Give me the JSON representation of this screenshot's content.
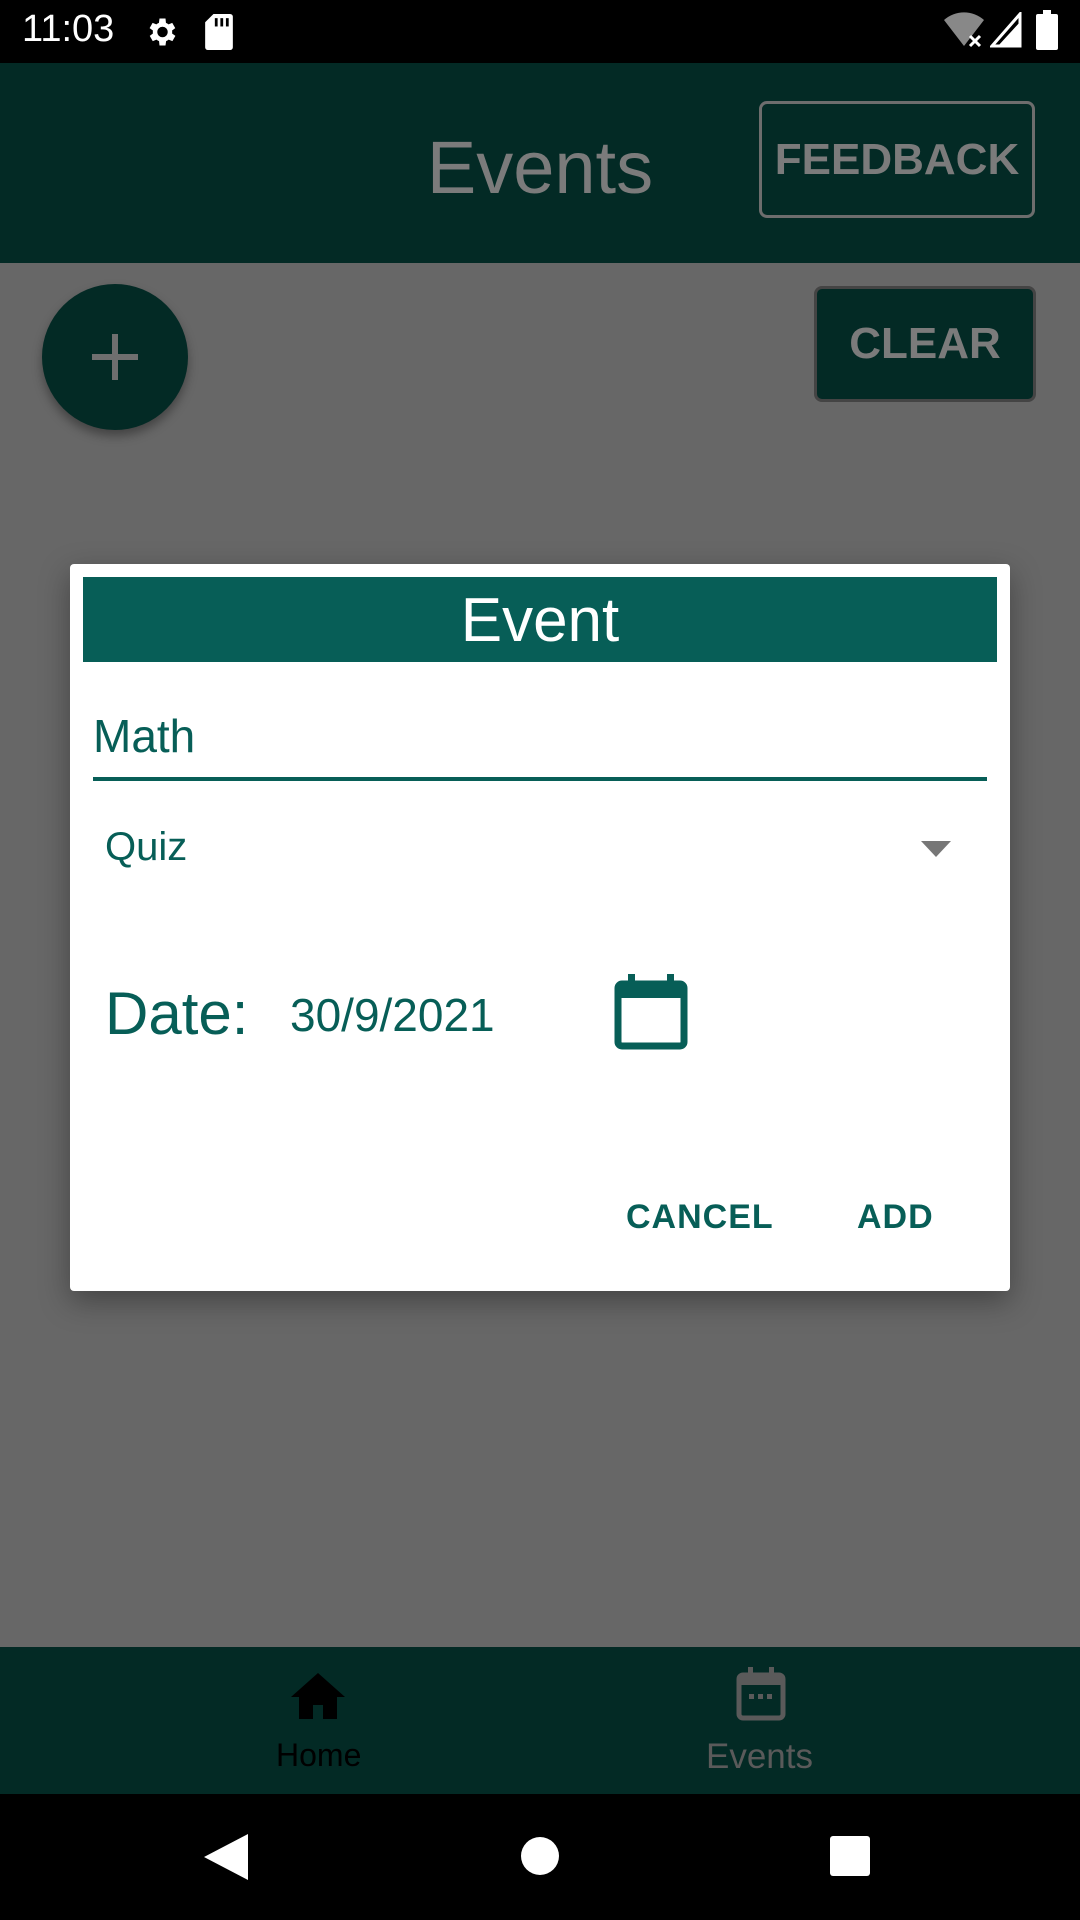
{
  "status_bar": {
    "time": "11:03",
    "icons": [
      "gear-icon",
      "sd-card-icon",
      "wifi-off-icon",
      "signal-icon",
      "battery-icon"
    ]
  },
  "app_bar": {
    "title": "Events",
    "feedback_label": "FEEDBACK"
  },
  "content": {
    "fab_icon": "plus-icon",
    "clear_label": "CLEAR"
  },
  "dialog": {
    "title": "Event",
    "name_value": "Math",
    "type_selected": "Quiz",
    "date_label": "Date:",
    "date_value": "30/9/2021",
    "cancel_label": "CANCEL",
    "add_label": "ADD"
  },
  "bottom_nav": {
    "items": [
      {
        "label": "Home",
        "icon": "home-icon"
      },
      {
        "label": "Events",
        "icon": "calendar-icon"
      }
    ]
  },
  "colors": {
    "primary": "#075e57",
    "primary_dark": "#032a25",
    "scrim": "#676767"
  }
}
